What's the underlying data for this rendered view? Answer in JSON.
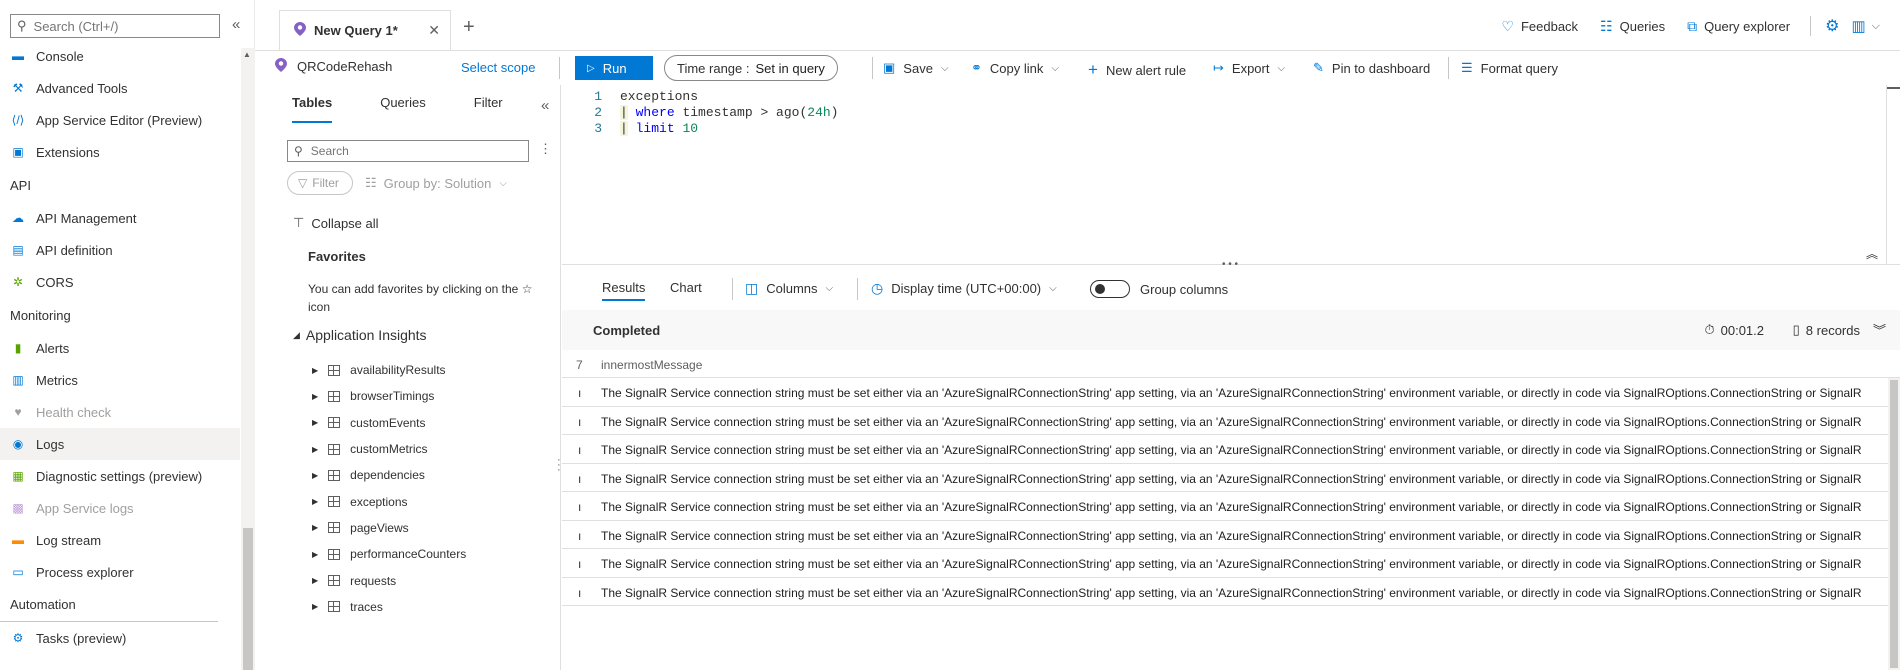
{
  "leftnav": {
    "search_placeholder": "Search (Ctrl+/)",
    "collapse_icon": "double-chevron-left",
    "items": [
      {
        "type": "item",
        "label": "Console",
        "icon": "console-icon",
        "color": "#0078d4",
        "state": "normal"
      },
      {
        "type": "item",
        "label": "Advanced Tools",
        "icon": "tools-icon",
        "color": "#0078d4",
        "state": "normal"
      },
      {
        "type": "item",
        "label": "App Service Editor (Preview)",
        "icon": "code-icon",
        "color": "#0078d4",
        "state": "normal"
      },
      {
        "type": "item",
        "label": "Extensions",
        "icon": "extensions-icon",
        "color": "#0078d4",
        "state": "normal"
      },
      {
        "type": "section",
        "label": "API"
      },
      {
        "type": "item",
        "label": "API Management",
        "icon": "cloud-icon",
        "color": "#0078d4",
        "state": "normal"
      },
      {
        "type": "item",
        "label": "API definition",
        "icon": "document-icon",
        "color": "#0078d4",
        "state": "normal"
      },
      {
        "type": "item",
        "label": "CORS",
        "icon": "globe-icon",
        "color": "#57a300",
        "state": "normal"
      },
      {
        "type": "section",
        "label": "Monitoring"
      },
      {
        "type": "item",
        "label": "Alerts",
        "icon": "alerts-icon",
        "color": "#57a300",
        "state": "normal"
      },
      {
        "type": "item",
        "label": "Metrics",
        "icon": "metrics-icon",
        "color": "#0078d4",
        "state": "normal"
      },
      {
        "type": "item",
        "label": "Health check",
        "icon": "heart-icon",
        "color": "#a19f9d",
        "state": "disabled"
      },
      {
        "type": "item",
        "label": "Logs",
        "icon": "logs-icon",
        "color": "#0078d4",
        "state": "active"
      },
      {
        "type": "item",
        "label": "Diagnostic settings (preview)",
        "icon": "diagnostic-icon",
        "color": "#57a300",
        "state": "normal"
      },
      {
        "type": "item",
        "label": "App Service logs",
        "icon": "service-logs-icon",
        "color": "#c19dd9",
        "state": "disabled"
      },
      {
        "type": "item",
        "label": "Log stream",
        "icon": "log-stream-icon",
        "color": "#ff8c00",
        "state": "normal"
      },
      {
        "type": "item",
        "label": "Process explorer",
        "icon": "monitor-icon",
        "color": "#0078d4",
        "state": "normal"
      },
      {
        "type": "section",
        "label": "Automation"
      },
      {
        "type": "item",
        "label": "Tasks (preview)",
        "icon": "tasks-icon",
        "color": "#0078d4",
        "state": "normal"
      }
    ]
  },
  "tabbar": {
    "tab_label": "New Query 1*",
    "close_glyph": "✕",
    "add_glyph": "+",
    "feedback": "Feedback",
    "queries": "Queries",
    "query_explorer": "Query explorer"
  },
  "cmdbar": {
    "scope_name": "QRCodeRehash",
    "select_scope": "Select scope",
    "run": "Run",
    "time_range_label": "Time range :",
    "time_range_value": "Set in query",
    "save": "Save",
    "copy_link": "Copy link",
    "new_alert_rule": "New alert rule",
    "export": "Export",
    "pin_to_dashboard": "Pin to dashboard",
    "format_query": "Format query"
  },
  "schema": {
    "tabs": [
      "Tables",
      "Queries",
      "Filter"
    ],
    "active_tab": "Tables",
    "search_placeholder": "Search",
    "filter_label": "Filter",
    "group_by": "Group by: Solution",
    "collapse_all": "Collapse all",
    "favorites_title": "Favorites",
    "favorites_text": "You can add favorites by clicking on the ☆ icon",
    "section": "Application Insights",
    "tables": [
      "availabilityResults",
      "browserTimings",
      "customEvents",
      "customMetrics",
      "dependencies",
      "exceptions",
      "pageViews",
      "performanceCounters",
      "requests",
      "traces"
    ]
  },
  "editor": {
    "lines": [
      {
        "n": "1",
        "code": "exceptions"
      },
      {
        "n": "2",
        "pipe": "|",
        "kw": "where",
        "rest": " timestamp > ago(",
        "num": "24h",
        "tail": ")"
      },
      {
        "n": "3",
        "pipe": "|",
        "kw": "limit",
        "rest": " ",
        "num": "10",
        "tail": ""
      }
    ]
  },
  "results": {
    "tabs": [
      "Results",
      "Chart"
    ],
    "columns_label": "Columns",
    "display_time": "Display time (UTC+00:00)",
    "group_columns": "Group columns",
    "status": "Completed",
    "elapsed": "00:01.2",
    "records": "8 records",
    "header_col0": "7",
    "header_col1": "innermostMessage",
    "row_prefix": "ı",
    "rows": [
      "The SignalR Service connection string must be set either via an 'AzureSignalRConnectionString' app setting, via an 'AzureSignalRConnectionString' environment variable, or directly in code via SignalROptions.ConnectionString or SignalR",
      "The SignalR Service connection string must be set either via an 'AzureSignalRConnectionString' app setting, via an 'AzureSignalRConnectionString' environment variable, or directly in code via SignalROptions.ConnectionString or SignalR",
      "The SignalR Service connection string must be set either via an 'AzureSignalRConnectionString' app setting, via an 'AzureSignalRConnectionString' environment variable, or directly in code via SignalROptions.ConnectionString or SignalR",
      "The SignalR Service connection string must be set either via an 'AzureSignalRConnectionString' app setting, via an 'AzureSignalRConnectionString' environment variable, or directly in code via SignalROptions.ConnectionString or SignalR",
      "The SignalR Service connection string must be set either via an 'AzureSignalRConnectionString' app setting, via an 'AzureSignalRConnectionString' environment variable, or directly in code via SignalROptions.ConnectionString or SignalR",
      "The SignalR Service connection string must be set either via an 'AzureSignalRConnectionString' app setting, via an 'AzureSignalRConnectionString' environment variable, or directly in code via SignalROptions.ConnectionString or SignalR",
      "The SignalR Service connection string must be set either via an 'AzureSignalRConnectionString' app setting, via an 'AzureSignalRConnectionString' environment variable, or directly in code via SignalROptions.ConnectionString or SignalR",
      "The SignalR Service connection string must be set either via an 'AzureSignalRConnectionString' app setting, via an 'AzureSignalRConnectionString' environment variable, or directly in code via SignalROptions.ConnectionString or SignalR"
    ]
  },
  "colors": {
    "accent": "#0078d4",
    "kusto_pin": "#8661c5",
    "keyword": "#0000ff",
    "number": "#098658"
  }
}
